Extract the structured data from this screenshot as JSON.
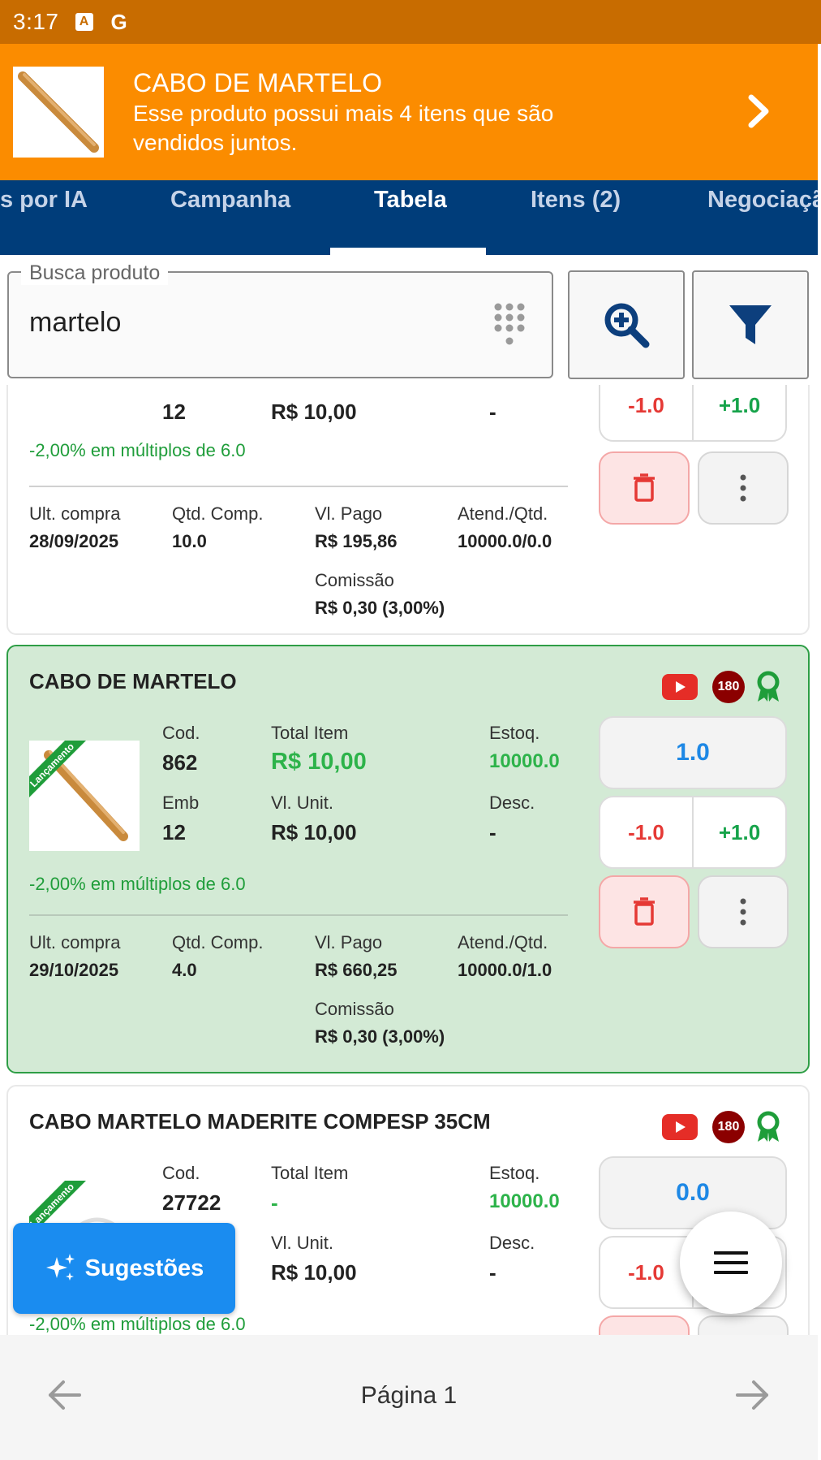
{
  "status_bar": {
    "time": "3:17",
    "icon_a": "A",
    "icon_g": "G"
  },
  "banner": {
    "title": "CABO DE MARTELO",
    "subtitle": "Esse produto possui mais 4 itens que são vendidos juntos."
  },
  "tabs": [
    {
      "label": "s por IA"
    },
    {
      "label": "Campanha"
    },
    {
      "label": "Tabela"
    },
    {
      "label": "Itens (2)"
    },
    {
      "label": "Negociaçã"
    }
  ],
  "active_tab": "Tabela",
  "search": {
    "label": "Busca produto",
    "value": "martelo"
  },
  "cards": [
    {
      "emb": "12",
      "vl_unit": "R$  10,00",
      "desc": "-",
      "promo": "-2,00% em múltiplos de 6.0",
      "stepper": {
        "minus": "-1.0",
        "plus": "+1.0"
      },
      "history": {
        "ult_compra_label": "Ult. compra",
        "ult_compra": "28/09/2025",
        "qtd_comp_label": "Qtd. Comp.",
        "qtd_comp": "10.0",
        "vl_pago_label": "Vl. Pago",
        "vl_pago": "R$  195,86",
        "atend_label": "Atend./Qtd.",
        "atend": "10000.0/0.0",
        "comissao_label": "Comissão",
        "comissao": "R$  0,30 (3,00%)"
      }
    },
    {
      "name": "CABO DE MARTELO",
      "badge": "180",
      "ribbon": "Lançamento",
      "cod_label": "Cod.",
      "cod": "862",
      "total_label": "Total Item",
      "total": "R$  10,00",
      "estoq_label": "Estoq.",
      "estoq": "10000.0",
      "emb_label": "Emb",
      "emb": "12",
      "vl_unit_label": "Vl. Unit.",
      "vl_unit": "R$  10,00",
      "desc_label": "Desc.",
      "desc": "-",
      "qty": "1.0",
      "stepper": {
        "minus": "-1.0",
        "plus": "+1.0"
      },
      "promo": "-2,00% em múltiplos de 6.0",
      "history": {
        "ult_compra_label": "Ult. compra",
        "ult_compra": "29/10/2025",
        "qtd_comp_label": "Qtd. Comp.",
        "qtd_comp": "4.0",
        "vl_pago_label": "Vl. Pago",
        "vl_pago": "R$  660,25",
        "atend_label": "Atend./Qtd.",
        "atend": "10000.0/1.0",
        "comissao_label": "Comissão",
        "comissao": "R$  0,30 (3,00%)"
      }
    },
    {
      "name": "CABO MARTELO MADERITE COMPESP 35CM",
      "badge": "180",
      "ribbon": "Lançamento",
      "cod_label": "Cod.",
      "cod": "27722",
      "total_label": "Total Item",
      "total": "-",
      "estoq_label": "Estoq.",
      "estoq": "10000.0",
      "vl_unit_label": "Vl. Unit.",
      "vl_unit": "R$  10,00",
      "desc_label": "Desc.",
      "desc": "-",
      "qty": "0.0",
      "stepper": {
        "minus": "-1.0"
      },
      "promo": "-2,00% em múltiplos de 6.0"
    }
  ],
  "suggestions_button": "Sugestões",
  "pager": {
    "label": "Página 1"
  },
  "colors": {
    "status_bar": "#c86c00",
    "banner": "#fb8c00",
    "tabs_bg": "#003d7a",
    "selected_card": "#d3ead5",
    "accent_blue": "#1a8cf0"
  },
  "icons": [
    "chevron-right-icon",
    "dialpad-icon",
    "zoom-in-icon",
    "filter-icon",
    "youtube-icon",
    "award-icon",
    "trash-icon",
    "more-vert-icon",
    "sparkles-icon",
    "menu-icon",
    "arrow-left-icon",
    "arrow-right-icon"
  ]
}
